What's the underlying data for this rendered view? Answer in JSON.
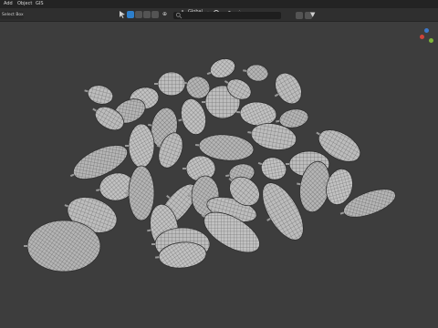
{
  "menu": {
    "items": [
      "Add",
      "Object",
      "GIS"
    ]
  },
  "toolbar": {
    "select_mode": "Select Box",
    "orientation": "Global",
    "search_placeholder": "",
    "icons": [
      "cursor-icon",
      "shading-solid-icon",
      "object-mode-icon",
      "snap-icon",
      "proportional-icon",
      "filter-icon"
    ]
  },
  "viewport": {
    "background": "#3d3d3d",
    "mesh_color": "#b9b9b9",
    "wire_color": "#444444",
    "object_description_hidden": true
  },
  "gizmo": {
    "axes": [
      {
        "name": "X",
        "color": "#d0433b"
      },
      {
        "name": "Y",
        "color": "#7fb53b"
      },
      {
        "name": "Z",
        "color": "#3c78c9"
      }
    ]
  }
}
